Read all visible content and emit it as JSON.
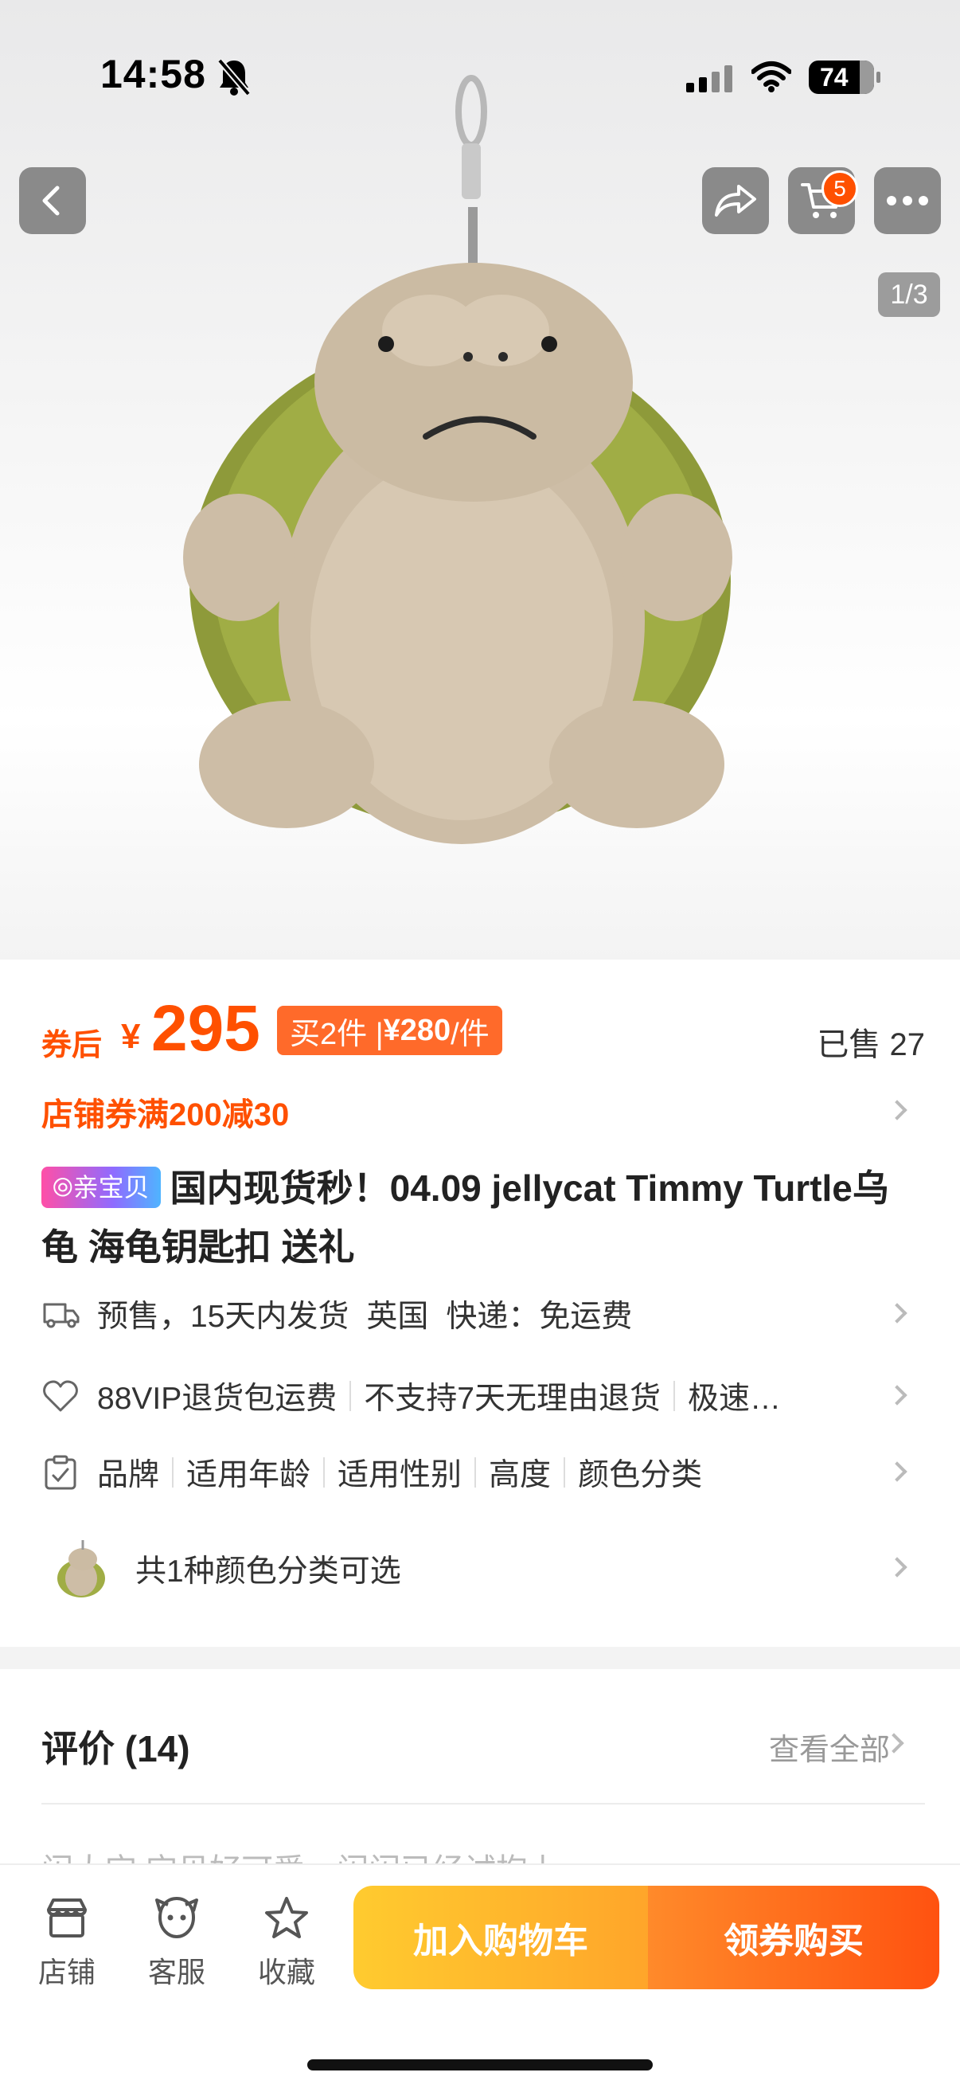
{
  "status_bar": {
    "time": "14:58",
    "battery": "74"
  },
  "gallery": {
    "index": "1/3"
  },
  "header": {
    "cart_count": "5"
  },
  "price": {
    "coupon_after_label": "券后",
    "currency": "¥",
    "amount": "295",
    "bulk_text_a": "买2件 | ",
    "bulk_price": "¥280",
    "bulk_text_b": "/件",
    "sold": "已售 27"
  },
  "shop_coupon": "店铺券满200减30",
  "title": {
    "badge": "亲宝贝",
    "text": "国内现货秒！04.09  jellycat Timmy Turtle乌龟 海龟钥匙扣 送礼"
  },
  "shipping": {
    "presale": "预售，15天内发货",
    "origin": "英国",
    "express": "快递：免运费"
  },
  "services": {
    "items": [
      "88VIP退货包运费",
      "不支持7天无理由退货",
      "极速…"
    ]
  },
  "attributes": {
    "items": [
      "品牌",
      "适用年龄",
      "适用性别",
      "高度",
      "颜色分类"
    ]
  },
  "color_option": {
    "text": "共1种颜色分类可选"
  },
  "reviews": {
    "title": "评价 (14)",
    "view_all": "查看全部",
    "peek": "闪大宝  宝贝好可爱，闪闪已经试抱上"
  },
  "bottom_bar": {
    "shop": "店铺",
    "service": "客服",
    "favorite": "收藏",
    "add_to_cart": "加入购物车",
    "buy": "领券购买"
  },
  "colors": {
    "accent": "#ff5000",
    "cart_gradient": [
      "#ffcb2f",
      "#ffa52a"
    ],
    "buy_gradient": [
      "#ff8a2a",
      "#ff5210"
    ]
  },
  "icons": [
    "back-icon",
    "share-icon",
    "cart-icon",
    "more-icon",
    "truck-icon",
    "heart-shield-icon",
    "clipboard-icon",
    "store-icon",
    "service-icon",
    "star-icon"
  ]
}
